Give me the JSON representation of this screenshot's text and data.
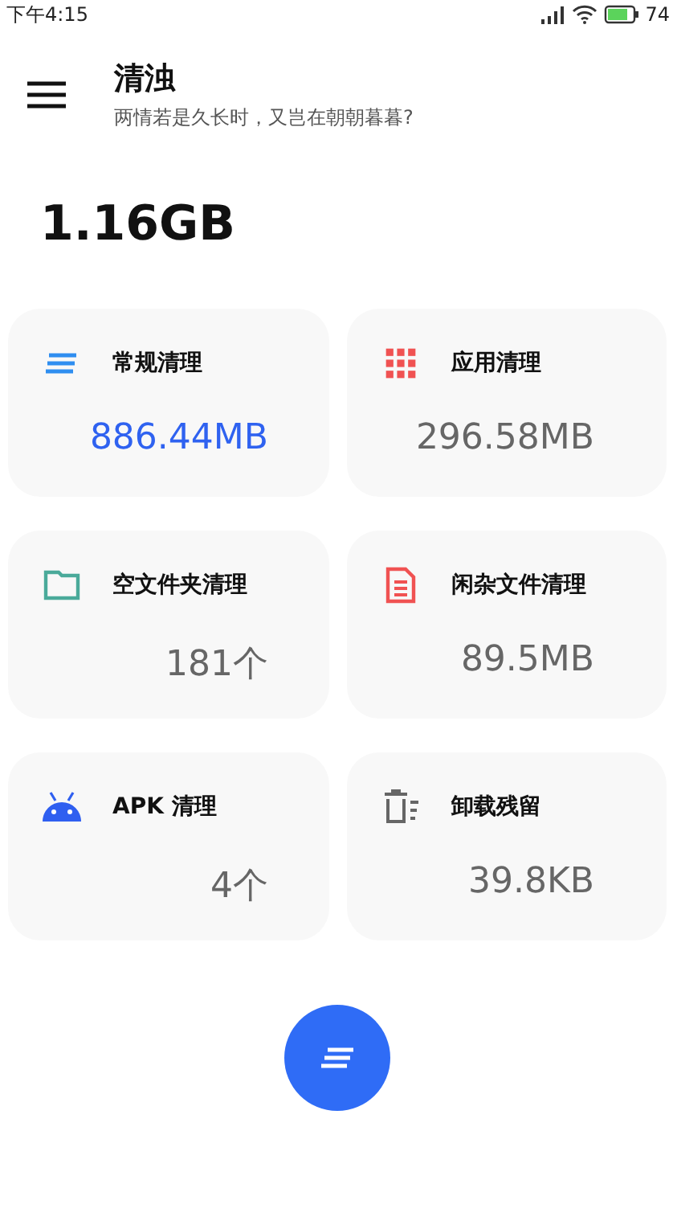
{
  "status_bar": {
    "time": "下午4:15",
    "battery": "74"
  },
  "header": {
    "title": "清浊",
    "subtitle": "两情若是久长时，又岂在朝朝暮暮?"
  },
  "total": "1.16GB",
  "cards": [
    {
      "kind": "lines",
      "title": "常规清理",
      "value": "886.44MB",
      "active": true
    },
    {
      "kind": "grid",
      "title": "应用清理",
      "value": "296.58MB",
      "active": false
    },
    {
      "kind": "folder",
      "title": "空文件夹清理",
      "value": "181个",
      "active": false
    },
    {
      "kind": "document",
      "title": "闲杂文件清理",
      "value": "89.5MB",
      "active": false
    },
    {
      "kind": "android",
      "title": "APK 清理",
      "value": "4个",
      "active": false
    },
    {
      "kind": "trash",
      "title": "卸载残留",
      "value": "39.8KB",
      "active": false
    }
  ]
}
